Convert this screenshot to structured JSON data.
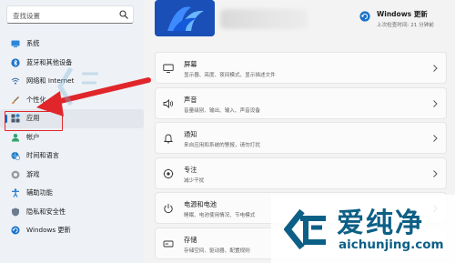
{
  "search": {
    "placeholder": "查找设置"
  },
  "sidebar": {
    "items": [
      {
        "label": "系统",
        "icon": "monitor-icon"
      },
      {
        "label": "蓝牙和其他设备",
        "icon": "bluetooth-icon"
      },
      {
        "label": "网络和 Internet",
        "icon": "wifi-icon"
      },
      {
        "label": "个性化",
        "icon": "paintbrush-icon"
      },
      {
        "label": "应用",
        "icon": "apps-icon",
        "selected": true
      },
      {
        "label": "帐户",
        "icon": "person-icon"
      },
      {
        "label": "时间和语言",
        "icon": "globe-clock-icon"
      },
      {
        "label": "游戏",
        "icon": "gamepad-icon"
      },
      {
        "label": "辅助功能",
        "icon": "accessibility-icon"
      },
      {
        "label": "隐私和安全性",
        "icon": "shield-icon"
      },
      {
        "label": "Windows 更新",
        "icon": "windows-update-icon"
      }
    ]
  },
  "header": {
    "update_title": "Windows 更新",
    "update_subtitle": "上次检查时间: 21 分钟前"
  },
  "main": {
    "cards": [
      {
        "title": "屏幕",
        "subtitle": "显示器、亮度、夜间模式、显示描述文件",
        "icon": "display-icon"
      },
      {
        "title": "声音",
        "subtitle": "音量级别、输出、输入、声音设备",
        "icon": "speaker-icon"
      },
      {
        "title": "通知",
        "subtitle": "来自应用和系统的警报，请勿打扰",
        "icon": "bell-icon"
      },
      {
        "title": "专注",
        "subtitle": "减少干扰",
        "icon": "focus-icon"
      },
      {
        "title": "电源和电池",
        "subtitle": "睡眠、电池使用情况、节电模式",
        "icon": "power-icon"
      },
      {
        "title": "存储",
        "subtitle": "存储空间、驱动器、配置规则",
        "icon": "storage-icon"
      }
    ]
  },
  "watermark": {
    "brand": "爱纯净",
    "url": "aichunjing.com"
  },
  "colors": {
    "accent": "#0067c0",
    "highlight": "#e0262b",
    "watermark": "#0c5f86"
  }
}
